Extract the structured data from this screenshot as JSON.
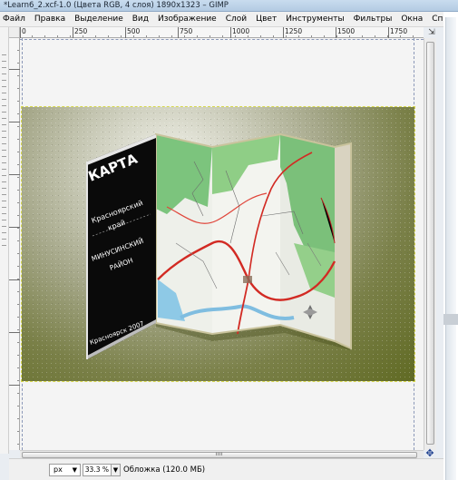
{
  "window": {
    "title": "*Learn6_2.xcf-1.0 (Цвета RGB, 4 слоя) 1890x1323 – GIMP"
  },
  "menu": [
    "Файл",
    "Правка",
    "Выделение",
    "Вид",
    "Изображение",
    "Слой",
    "Цвет",
    "Инструменты",
    "Фильтры",
    "Окна",
    "Справка"
  ],
  "ruler": {
    "labels": [
      "0",
      "250",
      "500",
      "750",
      "1000",
      "1250",
      "1500",
      "1750"
    ],
    "nav_glyph": "⇲"
  },
  "map_cover": {
    "title": "КАРТА",
    "region_line1": "Красноярский",
    "region_line2": "край",
    "district_line1": "МИНУСИНСКИЙ",
    "district_line2": "РАЙОН",
    "footer": "Красноярск 2007"
  },
  "status": {
    "unit": "px",
    "zoom": "33.3 %",
    "layer": "Обложка (120.0 МБ)"
  },
  "icons": {
    "nav_cross": "✥"
  }
}
